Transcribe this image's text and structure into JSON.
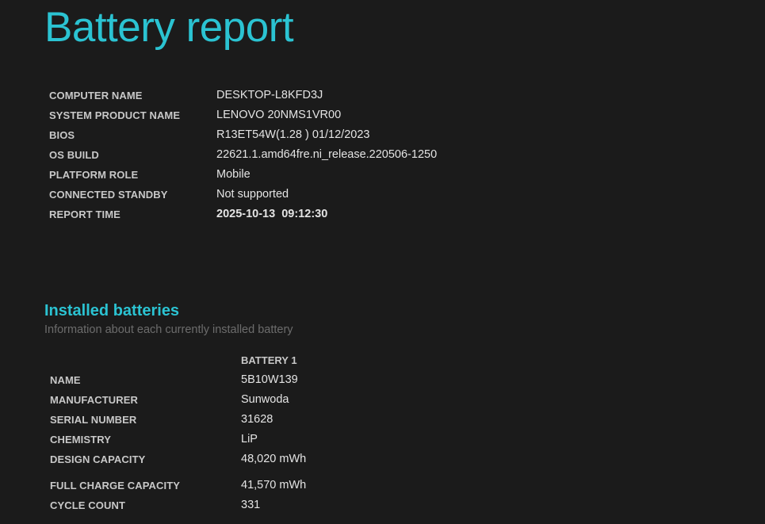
{
  "title": "Battery report",
  "system_info": [
    {
      "label": "COMPUTER NAME",
      "value": "DESKTOP-L8KFD3J"
    },
    {
      "label": "SYSTEM PRODUCT NAME",
      "value": "LENOVO 20NMS1VR00"
    },
    {
      "label": "BIOS",
      "value": "R13ET54W(1.28 ) 01/12/2023"
    },
    {
      "label": "OS BUILD",
      "value": "22621.1.amd64fre.ni_release.220506-1250"
    },
    {
      "label": "PLATFORM ROLE",
      "value": "Mobile"
    },
    {
      "label": "CONNECTED STANDBY",
      "value": "Not supported"
    },
    {
      "label": "REPORT TIME",
      "value": "2025-10-13  09:12:30"
    }
  ],
  "installed_batteries": {
    "title": "Installed batteries",
    "subtitle": "Information about each currently installed battery",
    "column_header": "BATTERY 1",
    "rows": [
      {
        "label": "NAME",
        "value": "5B10W139"
      },
      {
        "label": "MANUFACTURER",
        "value": "Sunwoda"
      },
      {
        "label": "SERIAL NUMBER",
        "value": "31628"
      },
      {
        "label": "CHEMISTRY",
        "value": "LiP"
      },
      {
        "label": "DESIGN CAPACITY",
        "value": "48,020 mWh"
      },
      {
        "label": "FULL CHARGE CAPACITY",
        "value": "41,570 mWh"
      },
      {
        "label": "CYCLE COUNT",
        "value": "331"
      }
    ]
  },
  "colors": {
    "background": "#1b1b1b",
    "accent": "#2bc3d2",
    "subtitle": "#6c6c6c"
  }
}
